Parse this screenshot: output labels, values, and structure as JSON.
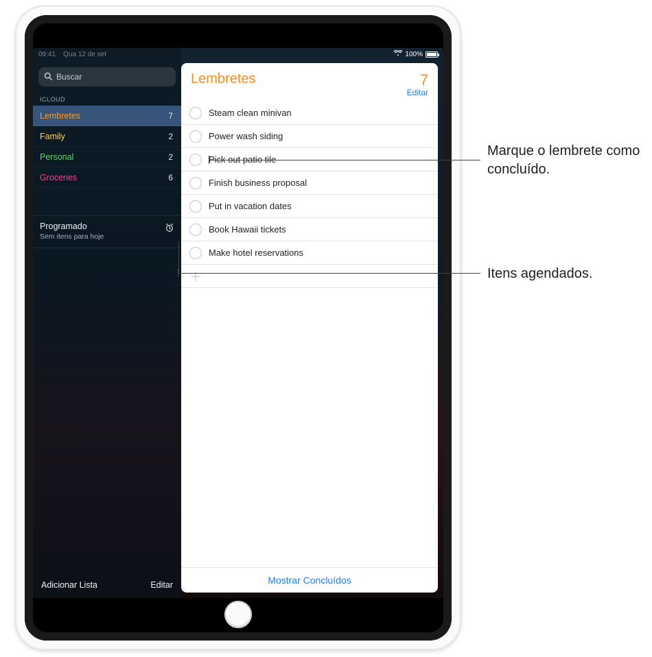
{
  "status": {
    "time": "09:41",
    "date": "Qua 12 de set",
    "battery": "100%",
    "wifi": "wifi-icon"
  },
  "search": {
    "placeholder": "Buscar"
  },
  "sidebar": {
    "section_label": "ICLOUD",
    "lists": [
      {
        "name": "Lembretes",
        "count": "7",
        "colorClass": "orange",
        "selected": true
      },
      {
        "name": "Family",
        "count": "2",
        "colorClass": "yellow",
        "selected": false
      },
      {
        "name": "Personal",
        "count": "2",
        "colorClass": "green",
        "selected": false
      },
      {
        "name": "Groceries",
        "count": "6",
        "colorClass": "pink",
        "selected": false
      }
    ],
    "scheduled_title": "Programado",
    "scheduled_sub": "Sem itens para hoje",
    "footer_add": "Adicionar Lista",
    "footer_edit": "Editar"
  },
  "main": {
    "title": "Lembretes",
    "count": "7",
    "edit_label": "Editar",
    "items": [
      "Steam clean minivan",
      "Power wash siding",
      "Pick out patio tile",
      "Finish business proposal",
      "Put in vacation dates",
      "Book Hawaii tickets",
      "Make hotel reservations"
    ],
    "footer_label": "Mostrar Concluídos"
  },
  "callouts": {
    "mark_done": "Marque o lembrete como concluído.",
    "scheduled": "Itens agendados."
  }
}
